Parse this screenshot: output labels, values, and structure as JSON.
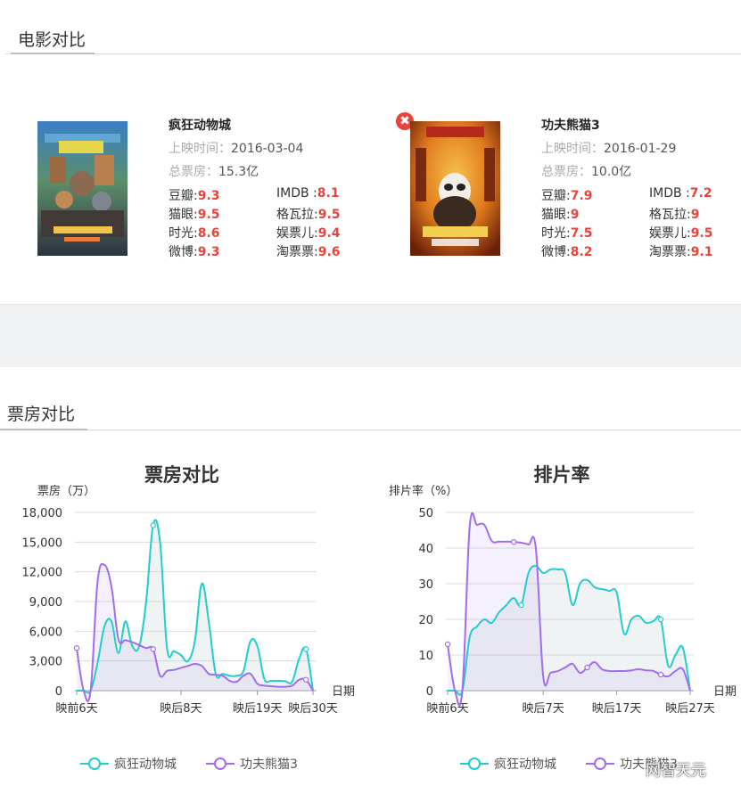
{
  "sections": {
    "movie_compare_title": "电影对比",
    "box_office_title": "票房对比"
  },
  "movies": [
    {
      "name": "疯狂动物城",
      "release_label": "上映时间：",
      "release_date": "2016-03-04",
      "box_label": "总票房：",
      "box_office": "15.3亿",
      "scores": [
        {
          "label": "豆瓣:",
          "value": "9.3"
        },
        {
          "label": "IMDB :",
          "value": "8.1"
        },
        {
          "label": "猫眼:",
          "value": "9.5"
        },
        {
          "label": "格瓦拉:",
          "value": "9.5"
        },
        {
          "label": "时光:",
          "value": "8.6"
        },
        {
          "label": "娱票儿:",
          "value": "9.4"
        },
        {
          "label": "微博:",
          "value": "9.3"
        },
        {
          "label": "淘票票:",
          "value": "9.6"
        }
      ],
      "poster_icon": "zootopia-poster-image"
    },
    {
      "name": "功夫熊猫3",
      "release_label": "上映时间：",
      "release_date": "2016-01-29",
      "box_label": "总票房：",
      "box_office": "10.0亿",
      "scores": [
        {
          "label": "豆瓣:",
          "value": "7.9"
        },
        {
          "label": "IMDB :",
          "value": "7.2"
        },
        {
          "label": "猫眼:",
          "value": "9"
        },
        {
          "label": "格瓦拉:",
          "value": "9"
        },
        {
          "label": "时光:",
          "value": "7.5"
        },
        {
          "label": "娱票儿:",
          "value": "9.5"
        },
        {
          "label": "微博:",
          "value": "8.2"
        },
        {
          "label": "淘票票:",
          "value": "9.1"
        }
      ],
      "poster_icon": "kungfu-panda-poster-image",
      "remove_icon": "✖"
    }
  ],
  "colors": {
    "series1": "#22ccd0",
    "series2": "#a26cf0",
    "accent_score": "#e8423c",
    "grid": "#dcdcdc"
  },
  "watermark": "网智天元",
  "chart_data": [
    {
      "type": "line",
      "title": "票房对比",
      "ylabel": "票房（万）",
      "xlabel": "日期",
      "ylim": [
        0,
        18000
      ],
      "yticks": [
        "0",
        "3,000",
        "6,000",
        "9,000",
        "12,000",
        "15,000",
        "18,000"
      ],
      "xtick_labels": [
        "映前6天",
        "映后8天",
        "映后19天",
        "映后30天"
      ],
      "xtick_index": [
        0,
        15,
        26,
        37
      ],
      "legend": [
        "疯狂动物城",
        "功夫熊猫3"
      ],
      "legend_position": "bottom-center",
      "grid": true,
      "series": [
        {
          "name": "疯狂动物城",
          "values": [
            0,
            0,
            0,
            2800,
            6500,
            7000,
            3800,
            7000,
            4500,
            4500,
            9000,
            16700,
            15000,
            4300,
            4000,
            3600,
            3000,
            5000,
            10800,
            7000,
            1700,
            1700,
            1500,
            1500,
            2000,
            5000,
            4500,
            1200,
            1000,
            1000,
            950,
            900,
            3200,
            4200,
            0
          ]
        },
        {
          "name": "功夫熊猫3",
          "values": [
            4300,
            0,
            0,
            11000,
            12700,
            10500,
            5200,
            5100,
            4900,
            4600,
            4300,
            4200,
            1500,
            2000,
            2100,
            2300,
            2500,
            2700,
            2500,
            1700,
            1600,
            1500,
            1000,
            900,
            1500,
            1700,
            700,
            500,
            450,
            400,
            400,
            500,
            1100,
            1100,
            0
          ]
        }
      ]
    },
    {
      "type": "line",
      "title": "排片率",
      "ylabel": "排片率（%）",
      "xlabel": "日期",
      "ylim": [
        0,
        50
      ],
      "yticks": [
        "0",
        "10",
        "20",
        "30",
        "40",
        "50"
      ],
      "xtick_labels": [
        "映前6天",
        "映后7天",
        "映后17天",
        "映后27天"
      ],
      "xtick_index": [
        0,
        13,
        23,
        33
      ],
      "legend": [
        "疯狂动物城",
        "功夫熊猫3"
      ],
      "legend_position": "bottom-center",
      "grid": true,
      "series": [
        {
          "name": "疯狂动物城",
          "values": [
            0,
            0,
            0,
            15,
            18,
            20,
            19,
            22,
            24,
            26,
            24,
            33,
            35,
            33,
            34,
            34,
            33,
            24,
            30,
            31,
            29,
            28.5,
            28,
            27.5,
            16,
            20,
            21,
            19,
            19.5,
            20,
            7,
            10,
            12,
            0
          ]
        },
        {
          "name": "功夫熊猫3",
          "values": [
            13,
            0,
            0,
            46,
            46.5,
            46.5,
            42,
            41.8,
            41.8,
            41.7,
            41.5,
            41,
            40,
            4,
            5,
            5.5,
            6.5,
            7.5,
            5,
            6.5,
            8,
            6,
            5.5,
            5.5,
            5.5,
            5.7,
            6,
            5.7,
            5.5,
            4.5,
            4,
            5.5,
            6,
            0
          ]
        }
      ]
    }
  ]
}
